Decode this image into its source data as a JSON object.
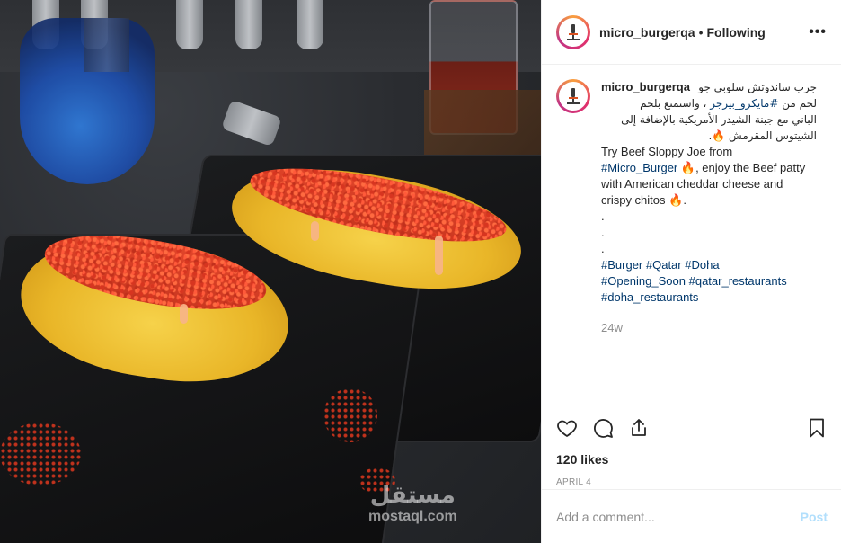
{
  "photo": {
    "watermark_arabic": "مستقل",
    "watermark_latin": "mostaql.com"
  },
  "header": {
    "username": "micro_burgerqa",
    "separator": "•",
    "follow_status": "Following",
    "more_icon": "more-horizontal-icon"
  },
  "caption": {
    "username": "micro_burgerqa",
    "arabic_lines": [
      "جرب ساندوتش سلوبي جو",
      "لحم من ",
      "#مايكرو_بيرجر",
      " ، واستمتع بلحم",
      "الباني مع جبنة الشيدر الأمريكية بالإضافة إلى",
      "الشيتوس المقرمش 🔥."
    ],
    "english_line_1": "Try Beef Sloppy Joe from",
    "english_tag": "#Micro_Burger",
    "english_line_2": " 🔥, enjoy the Beef patty",
    "english_line_3": "with American cheddar cheese and",
    "english_line_4": "crispy chitos 🔥.",
    "dots": [
      ".",
      ".",
      "."
    ],
    "hashtags_line_1": [
      "#Burger",
      "#Qatar",
      "#Doha"
    ],
    "hashtags_line_2": [
      "#Opening_Soon",
      "#qatar_restaurants"
    ],
    "hashtags_line_3": [
      "#doha_restaurants"
    ],
    "age": "24w"
  },
  "actions": {
    "icons": [
      "heart-icon",
      "comment-icon",
      "share-icon",
      "bookmark-icon"
    ],
    "likes": "120 likes",
    "date": "APRIL 4"
  },
  "add_comment": {
    "placeholder": "Add a comment...",
    "post_label": "Post"
  },
  "colors": {
    "link": "#00376b",
    "muted": "#8e8e8e",
    "post_disabled": "#b2dffc",
    "story_ring_start": "#f9a03f",
    "story_ring_end": "#c13584"
  }
}
